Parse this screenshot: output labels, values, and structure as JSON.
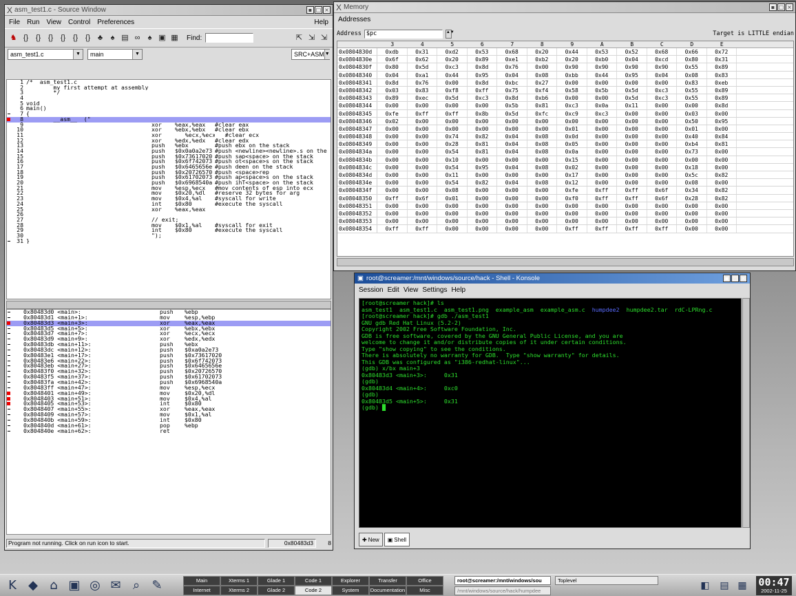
{
  "source_window": {
    "title": "asm_test1.c - Source Window",
    "menu": [
      "File",
      "Run",
      "View",
      "Control",
      "Preferences"
    ],
    "help": "Help",
    "find_label": "Find:",
    "file_combo": "asm_test1.c",
    "func_combo": "main",
    "mode_combo": "SRC+ASM",
    "status_text": "Program not running. Click on run icon to start.",
    "status_addr": "0x80483d3",
    "status_line": "8",
    "code_lines": [
      {
        "m": "",
        "n": "1",
        "a": "/*  asm_test1.c",
        "o": "",
        "p": "",
        "c": ""
      },
      {
        "m": "",
        "n": "2",
        "a": "        my first attempt at assembly coding",
        "o": "",
        "p": "",
        "c": ""
      },
      {
        "m": "",
        "n": "3",
        "a": "        */",
        "o": "",
        "p": "",
        "c": ""
      },
      {
        "m": "",
        "n": "4",
        "a": "",
        "o": "",
        "p": "",
        "c": ""
      },
      {
        "m": "",
        "n": "5",
        "a": "void",
        "o": "",
        "p": "",
        "c": ""
      },
      {
        "m": "",
        "n": "6",
        "a": "main()",
        "o": "",
        "p": "",
        "c": ""
      },
      {
        "m": "dash",
        "n": "7",
        "a": "{",
        "o": "",
        "p": "",
        "c": ""
      },
      {
        "m": "bp",
        "n": "8",
        "a": "        __asm__  (\"",
        "o": "",
        "p": "",
        "c": "",
        "hl": true
      },
      {
        "m": "",
        "n": "9",
        "a": "",
        "o": "xor",
        "p": "%eax,%eax",
        "c": "#clear eax"
      },
      {
        "m": "",
        "n": "10",
        "a": "",
        "o": "xor",
        "p": "%ebx,%ebx",
        "c": "#clear ebx"
      },
      {
        "m": "",
        "n": "11",
        "a": "",
        "o": "xor",
        "p": "   %ecx,%ecx",
        "c": "   #clear ecx"
      },
      {
        "m": "",
        "n": "12",
        "a": "",
        "o": "xor",
        "p": "%edx,%edx",
        "c": "#clear edx"
      },
      {
        "m": "",
        "n": "13",
        "a": "",
        "o": "push",
        "p": "%ebx",
        "c": "#push ebx on the stack"
      },
      {
        "m": "",
        "n": "14",
        "a": "",
        "o": "push",
        "p": "$0x0a0a2e73",
        "c": "#push <newline><newline>.s on the"
      },
      {
        "m": "",
        "n": "15",
        "a": "",
        "o": "push",
        "p": "$0x73617020",
        "c": "#push sap<space> on the stack"
      },
      {
        "m": "",
        "n": "16",
        "a": "",
        "o": "push",
        "p": "$0x6f742073",
        "c": "#push ot<space>s on the stack"
      },
      {
        "m": "",
        "n": "17",
        "a": "",
        "o": "push",
        "p": "$0x6465656e",
        "c": "#push deen on the stack"
      },
      {
        "m": "",
        "n": "18",
        "a": "",
        "o": "push",
        "p": "$0x20726570",
        "c": "#push <space>rep"
      },
      {
        "m": "",
        "n": "19",
        "a": "",
        "o": "push",
        "p": "$0x61702073",
        "c": "#push ap<space>s on the stack"
      },
      {
        "m": "",
        "n": "20",
        "a": "",
        "o": "push",
        "p": "$0x6968540a",
        "c": "#push ihT<space> on the stack"
      },
      {
        "m": "",
        "n": "21",
        "a": "",
        "o": "mov",
        "p": "%esp,%ecx",
        "c": "#mov contents of esp into ecx"
      },
      {
        "m": "",
        "n": "22",
        "a": "",
        "o": "mov",
        "p": "$0x20,%dl",
        "c": "#reserve 32 bytes for arg"
      },
      {
        "m": "",
        "n": "23",
        "a": "",
        "o": "mov",
        "p": "$0x4,%al",
        "c": "#syscall for write"
      },
      {
        "m": "",
        "n": "24",
        "a": "",
        "o": "int",
        "p": "$0x80",
        "c": "#execute the syscall"
      },
      {
        "m": "",
        "n": "25",
        "a": "",
        "o": "xor",
        "p": "%eax,%eax",
        "c": ""
      },
      {
        "m": "",
        "n": "26",
        "a": "",
        "o": "",
        "p": "",
        "c": ""
      },
      {
        "m": "",
        "n": "27",
        "a": "",
        "o": "// exit;",
        "p": "",
        "c": ""
      },
      {
        "m": "",
        "n": "28",
        "a": "",
        "o": "mov",
        "p": "$0x1,%al",
        "c": "#syscall for exit"
      },
      {
        "m": "",
        "n": "29",
        "a": "",
        "o": "int",
        "p": "$0x80",
        "c": "#execute the syscall"
      },
      {
        "m": "",
        "n": "30",
        "a": "",
        "o": "\");",
        "p": "",
        "c": ""
      },
      {
        "m": "dash",
        "n": "31",
        "a": "}",
        "o": "",
        "p": "",
        "c": ""
      }
    ],
    "asm_lines": [
      {
        "m": "dash",
        "ad": "0x80483d0 <main>:",
        "o": "push",
        "p": "%ebp"
      },
      {
        "m": "dash",
        "ad": "0x80483d1 <main+1>:",
        "o": "mov",
        "p": "%esp,%ebp"
      },
      {
        "m": "bp",
        "ad": "0x80483d3 <main+3>:",
        "o": "xor",
        "p": "%eax,%eax",
        "hl": true
      },
      {
        "m": "dash",
        "ad": "0x80483d5 <main+5>:",
        "o": "xor",
        "p": "%ebx,%ebx"
      },
      {
        "m": "dash",
        "ad": "0x80483d7 <main+7>:",
        "o": "xor",
        "p": "%ecx,%ecx"
      },
      {
        "m": "dash",
        "ad": "0x80483d9 <main+9>:",
        "o": "xor",
        "p": "%edx,%edx"
      },
      {
        "m": "dash",
        "ad": "0x80483db <main+11>:",
        "o": "push",
        "p": "%ebx"
      },
      {
        "m": "dash",
        "ad": "0x80483dc <main+12>:",
        "o": "push",
        "p": "$0xa0a2e73"
      },
      {
        "m": "dash",
        "ad": "0x80483e1 <main+17>:",
        "o": "push",
        "p": "$0x73617020"
      },
      {
        "m": "dash",
        "ad": "0x80483e6 <main+22>:",
        "o": "push",
        "p": "$0x6f742073"
      },
      {
        "m": "dash",
        "ad": "0x80483eb <main+27>:",
        "o": "push",
        "p": "$0x6465656e"
      },
      {
        "m": "dash",
        "ad": "0x80483f0 <main+32>:",
        "o": "push",
        "p": "$0x20726570"
      },
      {
        "m": "dash",
        "ad": "0x80483f5 <main+37>:",
        "o": "push",
        "p": "$0x61702073"
      },
      {
        "m": "dash",
        "ad": "0x80483fa <main+42>:",
        "o": "push",
        "p": "$0x6968540a"
      },
      {
        "m": "dash",
        "ad": "0x80483ff <main+47>:",
        "o": "mov",
        "p": "%esp,%ecx"
      },
      {
        "m": "bp",
        "ad": "0x8048401 <main+49>:",
        "o": "mov",
        "p": "$0x20,%dl"
      },
      {
        "m": "bp",
        "ad": "0x8048403 <main+51>:",
        "o": "mov",
        "p": "$0x4,%al"
      },
      {
        "m": "bp",
        "ad": "0x8048405 <main+53>:",
        "o": "int",
        "p": "$0x80"
      },
      {
        "m": "dash",
        "ad": "0x8048407 <main+55>:",
        "o": "xor",
        "p": "%eax,%eax"
      },
      {
        "m": "dash",
        "ad": "0x8048409 <main+57>:",
        "o": "mov",
        "p": "$0x1,%al"
      },
      {
        "m": "dash",
        "ad": "0x804840b <main+59>:",
        "o": "int",
        "p": "$0x80"
      },
      {
        "m": "dash",
        "ad": "0x804840d <main+61>:",
        "o": "pop",
        "p": "%ebp"
      },
      {
        "m": "dash",
        "ad": "0x804840e <main+62>:",
        "o": "ret",
        "p": ""
      }
    ]
  },
  "memory_window": {
    "title": "Memory",
    "menu": "Addresses",
    "address_label": "Address",
    "address_value": "$pc",
    "endian": "Target is LITTLE endian",
    "columns": [
      "3",
      "4",
      "5",
      "6",
      "7",
      "8",
      "9",
      "A",
      "B",
      "C",
      "D",
      "E"
    ],
    "rows": [
      {
        "a": "0x0804830d",
        "v": [
          "0xdb",
          "0x31",
          "0xd2",
          "0x53",
          "0x68",
          "0x20",
          "0x44",
          "0x53",
          "0x52",
          "0x68",
          "0x66",
          "0x72"
        ]
      },
      {
        "a": "0x0804830e",
        "v": [
          "0x6f",
          "0x62",
          "0x20",
          "0x89",
          "0xe1",
          "0xb2",
          "0x20",
          "0xb0",
          "0x04",
          "0xcd",
          "0x80",
          "0x31"
        ]
      },
      {
        "a": "0x0804830f",
        "v": [
          "0x80",
          "0x5d",
          "0xc3",
          "0x8d",
          "0x76",
          "0x00",
          "0x90",
          "0x90",
          "0x90",
          "0x90",
          "0x55",
          "0x89"
        ]
      },
      {
        "a": "0x08048340",
        "v": [
          "0x04",
          "0xa1",
          "0x44",
          "0x95",
          "0x04",
          "0x08",
          "0xbb",
          "0x44",
          "0x95",
          "0x04",
          "0x08",
          "0x83"
        ]
      },
      {
        "a": "0x08048341",
        "v": [
          "0x8d",
          "0x76",
          "0x00",
          "0x8d",
          "0xbc",
          "0x27",
          "0x00",
          "0x00",
          "0x00",
          "0x00",
          "0x83",
          "0xeb"
        ]
      },
      {
        "a": "0x08048342",
        "v": [
          "0x03",
          "0x83",
          "0xf8",
          "0xff",
          "0x75",
          "0xf4",
          "0x58",
          "0x5b",
          "0x5d",
          "0xc3",
          "0x55",
          "0x89"
        ]
      },
      {
        "a": "0x08048343",
        "v": [
          "0x89",
          "0xec",
          "0x5d",
          "0xc3",
          "0x8d",
          "0xb6",
          "0x00",
          "0x00",
          "0x5d",
          "0xc3",
          "0x55",
          "0x89"
        ]
      },
      {
        "a": "0x08048344",
        "v": [
          "0x00",
          "0x00",
          "0x00",
          "0x00",
          "0x5b",
          "0x81",
          "0xc3",
          "0x0a",
          "0x11",
          "0x00",
          "0x00",
          "0x8d"
        ]
      },
      {
        "a": "0x08048345",
        "v": [
          "0xfe",
          "0xff",
          "0xff",
          "0x8b",
          "0x5d",
          "0xfc",
          "0xc9",
          "0xc3",
          "0x00",
          "0x00",
          "0x03",
          "0x00"
        ]
      },
      {
        "a": "0x08048346",
        "v": [
          "0x02",
          "0x00",
          "0x00",
          "0x00",
          "0x00",
          "0x00",
          "0x00",
          "0x00",
          "0x00",
          "0x00",
          "0x50",
          "0x95"
        ]
      },
      {
        "a": "0x08048347",
        "v": [
          "0x00",
          "0x00",
          "0x00",
          "0x00",
          "0x00",
          "0x00",
          "0x01",
          "0x00",
          "0x00",
          "0x00",
          "0x01",
          "0x00"
        ]
      },
      {
        "a": "0x08048348",
        "v": [
          "0x00",
          "0x00",
          "0x74",
          "0x82",
          "0x04",
          "0x08",
          "0x0d",
          "0x00",
          "0x00",
          "0x00",
          "0x40",
          "0x84"
        ]
      },
      {
        "a": "0x08048349",
        "v": [
          "0x00",
          "0x00",
          "0x28",
          "0x81",
          "0x04",
          "0x08",
          "0x05",
          "0x00",
          "0x00",
          "0x00",
          "0xb4",
          "0x81"
        ]
      },
      {
        "a": "0x0804834a",
        "v": [
          "0x00",
          "0x00",
          "0x54",
          "0x81",
          "0x04",
          "0x08",
          "0x0a",
          "0x00",
          "0x00",
          "0x00",
          "0x73",
          "0x00"
        ]
      },
      {
        "a": "0x0804834b",
        "v": [
          "0x00",
          "0x00",
          "0x10",
          "0x00",
          "0x00",
          "0x00",
          "0x15",
          "0x00",
          "0x00",
          "0x00",
          "0x00",
          "0x00"
        ]
      },
      {
        "a": "0x0804834c",
        "v": [
          "0x00",
          "0x00",
          "0x54",
          "0x95",
          "0x04",
          "0x08",
          "0x02",
          "0x00",
          "0x00",
          "0x00",
          "0x18",
          "0x00"
        ]
      },
      {
        "a": "0x0804834d",
        "v": [
          "0x00",
          "0x00",
          "0x11",
          "0x00",
          "0x00",
          "0x00",
          "0x17",
          "0x00",
          "0x00",
          "0x00",
          "0x5c",
          "0x82"
        ]
      },
      {
        "a": "0x0804834e",
        "v": [
          "0x00",
          "0x00",
          "0x54",
          "0x82",
          "0x04",
          "0x08",
          "0x12",
          "0x00",
          "0x00",
          "0x00",
          "0x08",
          "0x00"
        ]
      },
      {
        "a": "0x0804834f",
        "v": [
          "0x00",
          "0x00",
          "0x08",
          "0x00",
          "0x00",
          "0x00",
          "0xfe",
          "0xff",
          "0xff",
          "0x6f",
          "0x34",
          "0x82"
        ]
      },
      {
        "a": "0x08048350",
        "v": [
          "0xff",
          "0x6f",
          "0x01",
          "0x00",
          "0x00",
          "0x00",
          "0xf0",
          "0xff",
          "0xff",
          "0x6f",
          "0x28",
          "0x82"
        ]
      },
      {
        "a": "0x08048351",
        "v": [
          "0x00",
          "0x00",
          "0x00",
          "0x00",
          "0x00",
          "0x00",
          "0x00",
          "0x00",
          "0x00",
          "0x00",
          "0x00",
          "0x00"
        ]
      },
      {
        "a": "0x08048352",
        "v": [
          "0x00",
          "0x00",
          "0x00",
          "0x00",
          "0x00",
          "0x00",
          "0x00",
          "0x00",
          "0x00",
          "0x00",
          "0x00",
          "0x00"
        ]
      },
      {
        "a": "0x08048353",
        "v": [
          "0x00",
          "0x00",
          "0x00",
          "0x00",
          "0x00",
          "0x00",
          "0x00",
          "0x00",
          "0x00",
          "0x00",
          "0x00",
          "0x00"
        ]
      },
      {
        "a": "0x08048354",
        "v": [
          "0xff",
          "0xff",
          "0x00",
          "0x00",
          "0x00",
          "0x00",
          "0xff",
          "0xff",
          "0xff",
          "0xff",
          "0x00",
          "0x00"
        ]
      }
    ]
  },
  "konsole": {
    "title": "root@screamer:/mnt/windows/source/hack - Shell - Konsole",
    "menu": [
      "Session",
      "Edit",
      "View",
      "Settings",
      "Help"
    ],
    "lines": [
      [
        {
          "t": "[root@screamer hack]# ls"
        }
      ],
      [
        {
          "t": "asm_test1  asm_test1.c  asm_test1.png  example_asm  example_asm.c  "
        },
        {
          "t": "humpdee2",
          "c": "blue"
        },
        {
          "t": "  humpdee2.tar  rdC-LPRng.c"
        }
      ],
      [
        {
          "t": "[root@screamer hack]# gdb ./asm_test1"
        }
      ],
      [
        {
          "t": "GNU gdb Red Hat Linux (5.2-2)"
        }
      ],
      [
        {
          "t": "Copyright 2002 Free Software Foundation, Inc."
        }
      ],
      [
        {
          "t": "GDB is free software, covered by the GNU General Public License, and you are"
        }
      ],
      [
        {
          "t": "welcome to change it and/or distribute copies of it under certain conditions."
        }
      ],
      [
        {
          "t": "Type \"show copying\" to see the conditions."
        }
      ],
      [
        {
          "t": "There is absolutely no warranty for GDB.  Type \"show warranty\" for details."
        }
      ],
      [
        {
          "t": "This GDB was configured as \"i386-redhat-linux\"..."
        }
      ],
      [
        {
          "t": "(gdb) x/bx main+3"
        }
      ],
      [
        {
          "t": "0x80483d3 <main+3>:     0x31"
        }
      ],
      [
        {
          "t": "(gdb)"
        }
      ],
      [
        {
          "t": "0x80483d4 <main+4>:     0xc0"
        }
      ],
      [
        {
          "t": "(gdb)"
        }
      ],
      [
        {
          "t": "0x80483d5 <main+5>:     0x31"
        }
      ],
      [
        {
          "t": "(gdb) █"
        }
      ]
    ],
    "tab_new": "New",
    "tab_shell": "Shell"
  },
  "taskbar": {
    "desktops_top": [
      "Main",
      "Xterms 1",
      "Glade 1",
      "Code 1",
      "Explorer",
      "Transfer",
      "Office"
    ],
    "desktops_bottom": [
      "Internet",
      "Xterms 2",
      "Glade 2",
      "Code 2",
      "System",
      "Documentation",
      "Misc"
    ],
    "active_desktop": "Code 2",
    "task1": "root@screamer:/mnt/windows/sou",
    "task1_sub": "/mnt/windows/source/hack/humpdee",
    "task2": "Toplevel",
    "clock_time": "00:47",
    "clock_date": "2002-11-25"
  }
}
